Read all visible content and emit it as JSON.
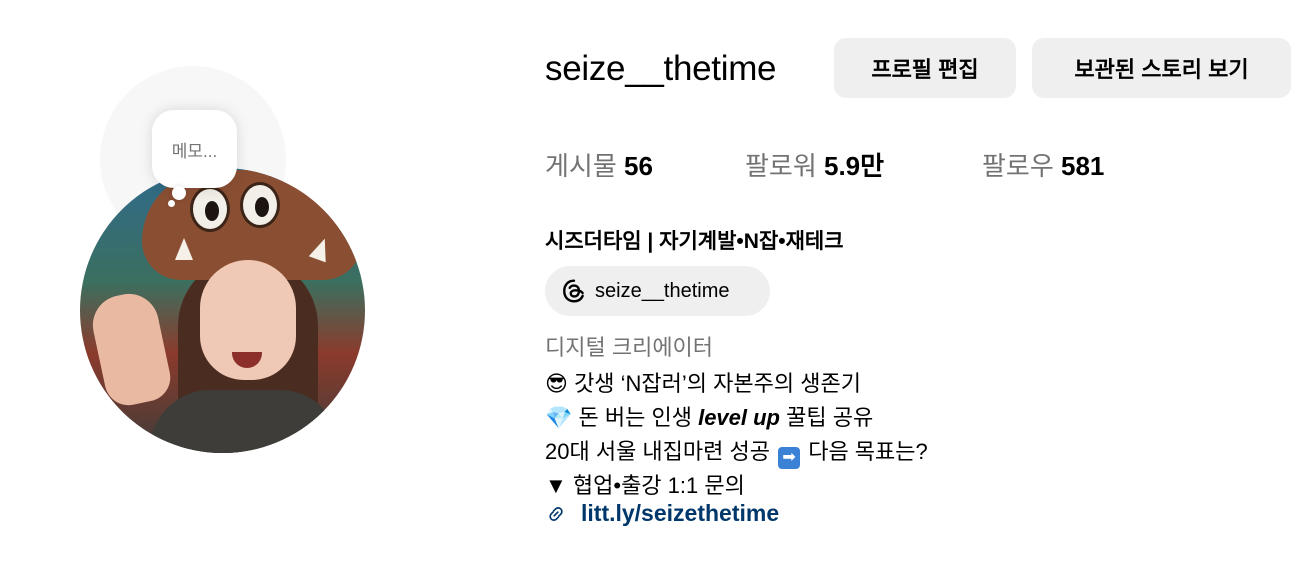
{
  "profile": {
    "username": "seize__thetime",
    "note_placeholder": "메모...",
    "buttons": {
      "edit_profile": "프로필 편집",
      "view_archive": "보관된 스토리 보기"
    },
    "stats": {
      "posts_label": "게시물",
      "posts_count": "56",
      "followers_label": "팔로워",
      "followers_count": "5.9만",
      "following_label": "팔로우",
      "following_count": "581"
    },
    "full_name": "시즈더타임 | 자기계발•N잡•재테크",
    "threads_handle": "seize__thetime",
    "category": "디지털 크리에이터",
    "bio": {
      "line1_emoji": "😎",
      "line1_text": "갓생 ‘N잡러’의 자본주의 생존기",
      "line2_emoji": "💎",
      "line2_pre": "돈 버는 인생 ",
      "line2_em": "level up",
      "line2_post": " 꿀팁 공유",
      "line3_pre": "20대 서울 내집마련 성공 ",
      "line3_arrow": "➡",
      "line3_post": " 다음 목표는?",
      "line4_text": "▼ 협업•출강 1:1 문의"
    },
    "link": "litt.ly/seizethetime"
  },
  "icons": {
    "threads": "threads-icon",
    "link": "link-icon"
  },
  "colors": {
    "button_bg": "#efefef",
    "muted_text": "#737373",
    "link": "#00376b"
  }
}
